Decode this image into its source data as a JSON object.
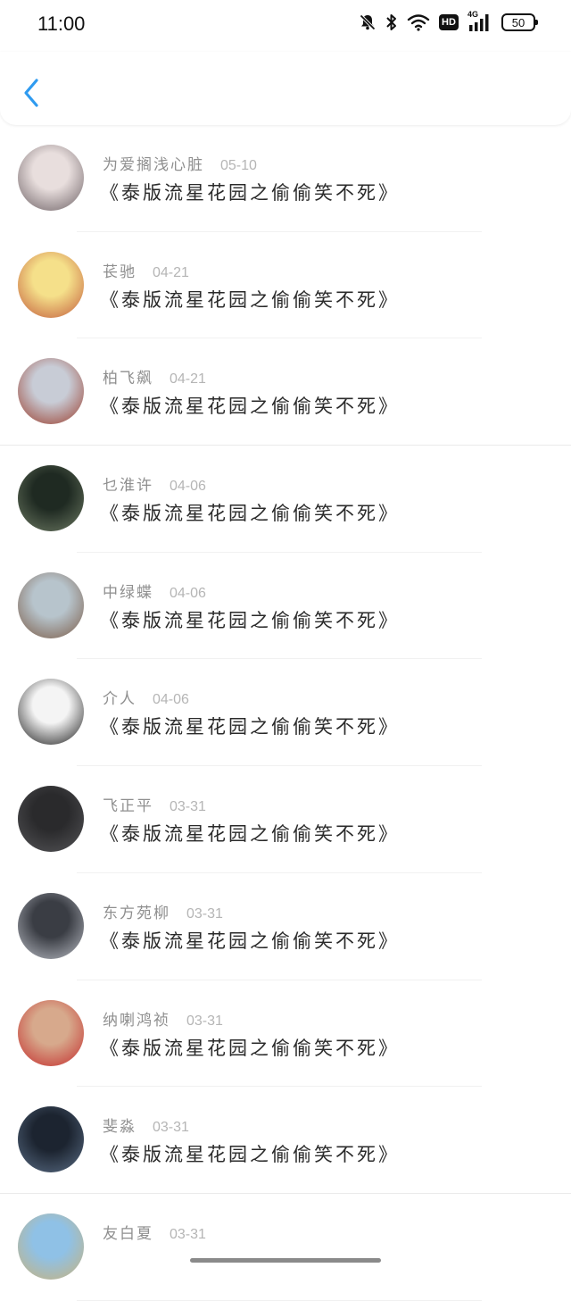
{
  "status_bar": {
    "time": "11:00",
    "network": "4G",
    "hd_label": "HD",
    "battery": "50"
  },
  "header": {
    "back_icon": "chevron-left-icon",
    "accent_color": "#2f9bf0"
  },
  "comments": [
    {
      "user": "为爱搁浅心脏",
      "date": "05-10",
      "text": "《泰版流星花园之偷偷笑不死》",
      "avatar_colors": [
        "#e8dedd",
        "#6b5f63"
      ]
    },
    {
      "user": "苌驰",
      "date": "04-21",
      "text": "《泰版流星花园之偷偷笑不死》",
      "avatar_colors": [
        "#f5e08a",
        "#c25a3a"
      ]
    },
    {
      "user": "柏飞飙",
      "date": "04-21",
      "text": "《泰版流星花园之偷偷笑不死》",
      "avatar_colors": [
        "#c8ccd6",
        "#9a3b2a"
      ]
    },
    {
      "user": "乜淮许",
      "date": "04-06",
      "text": "《泰版流星花园之偷偷笑不死》",
      "avatar_colors": [
        "#1f2a22",
        "#6d7a63"
      ]
    },
    {
      "user": "中绿蝶",
      "date": "04-06",
      "text": "《泰版流星花园之偷偷笑不死》",
      "avatar_colors": [
        "#b7c4cc",
        "#7a5a45"
      ]
    },
    {
      "user": "介人",
      "date": "04-06",
      "text": "《泰版流星花园之偷偷笑不死》",
      "avatar_colors": [
        "#f4f4f4",
        "#1a1a1a"
      ]
    },
    {
      "user": "飞正平",
      "date": "03-31",
      "text": "《泰版流星花园之偷偷笑不死》",
      "avatar_colors": [
        "#2a2a2c",
        "#555558"
      ]
    },
    {
      "user": "东方苑柳",
      "date": "03-31",
      "text": "《泰版流星花园之偷偷笑不死》",
      "avatar_colors": [
        "#3a3d44",
        "#b9bcc4"
      ]
    },
    {
      "user": "纳喇鸿祯",
      "date": "03-31",
      "text": "《泰版流星花园之偷偷笑不死》",
      "avatar_colors": [
        "#d7a98c",
        "#c42b2b"
      ]
    },
    {
      "user": "斐淼",
      "date": "03-31",
      "text": "《泰版流星花园之偷偷笑不死》",
      "avatar_colors": [
        "#1c2430",
        "#5a6d85"
      ]
    },
    {
      "user": "友白夏",
      "date": "03-31",
      "text": "",
      "avatar_colors": [
        "#8fc1e6",
        "#c9b27a"
      ]
    }
  ]
}
